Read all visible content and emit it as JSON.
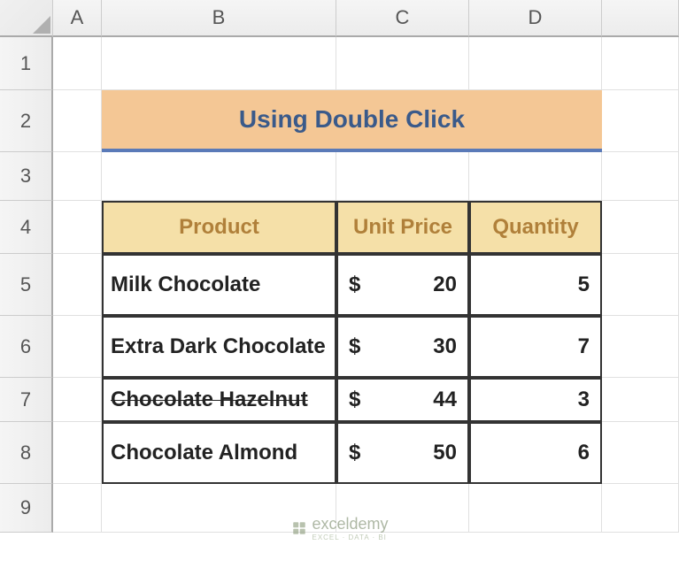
{
  "columns": [
    "A",
    "B",
    "C",
    "D"
  ],
  "rows": [
    "1",
    "2",
    "3",
    "4",
    "5",
    "6",
    "7",
    "8",
    "9"
  ],
  "title": "Using Double Click",
  "headers": {
    "product": "Product",
    "unitprice": "Unit Price",
    "quantity": "Quantity"
  },
  "currency": "$",
  "table": [
    {
      "product": "Milk Chocolate",
      "price": "20",
      "qty": "5"
    },
    {
      "product": "Extra Dark Chocolate",
      "price": "30",
      "qty": "7"
    },
    {
      "product": "Chocolate Hazelnut",
      "price": "44",
      "qty": "3"
    },
    {
      "product": "Chocolate Almond",
      "price": "50",
      "qty": "6"
    }
  ],
  "watermark": {
    "name": "exceldemy",
    "tagline": "EXCEL · DATA · BI"
  }
}
